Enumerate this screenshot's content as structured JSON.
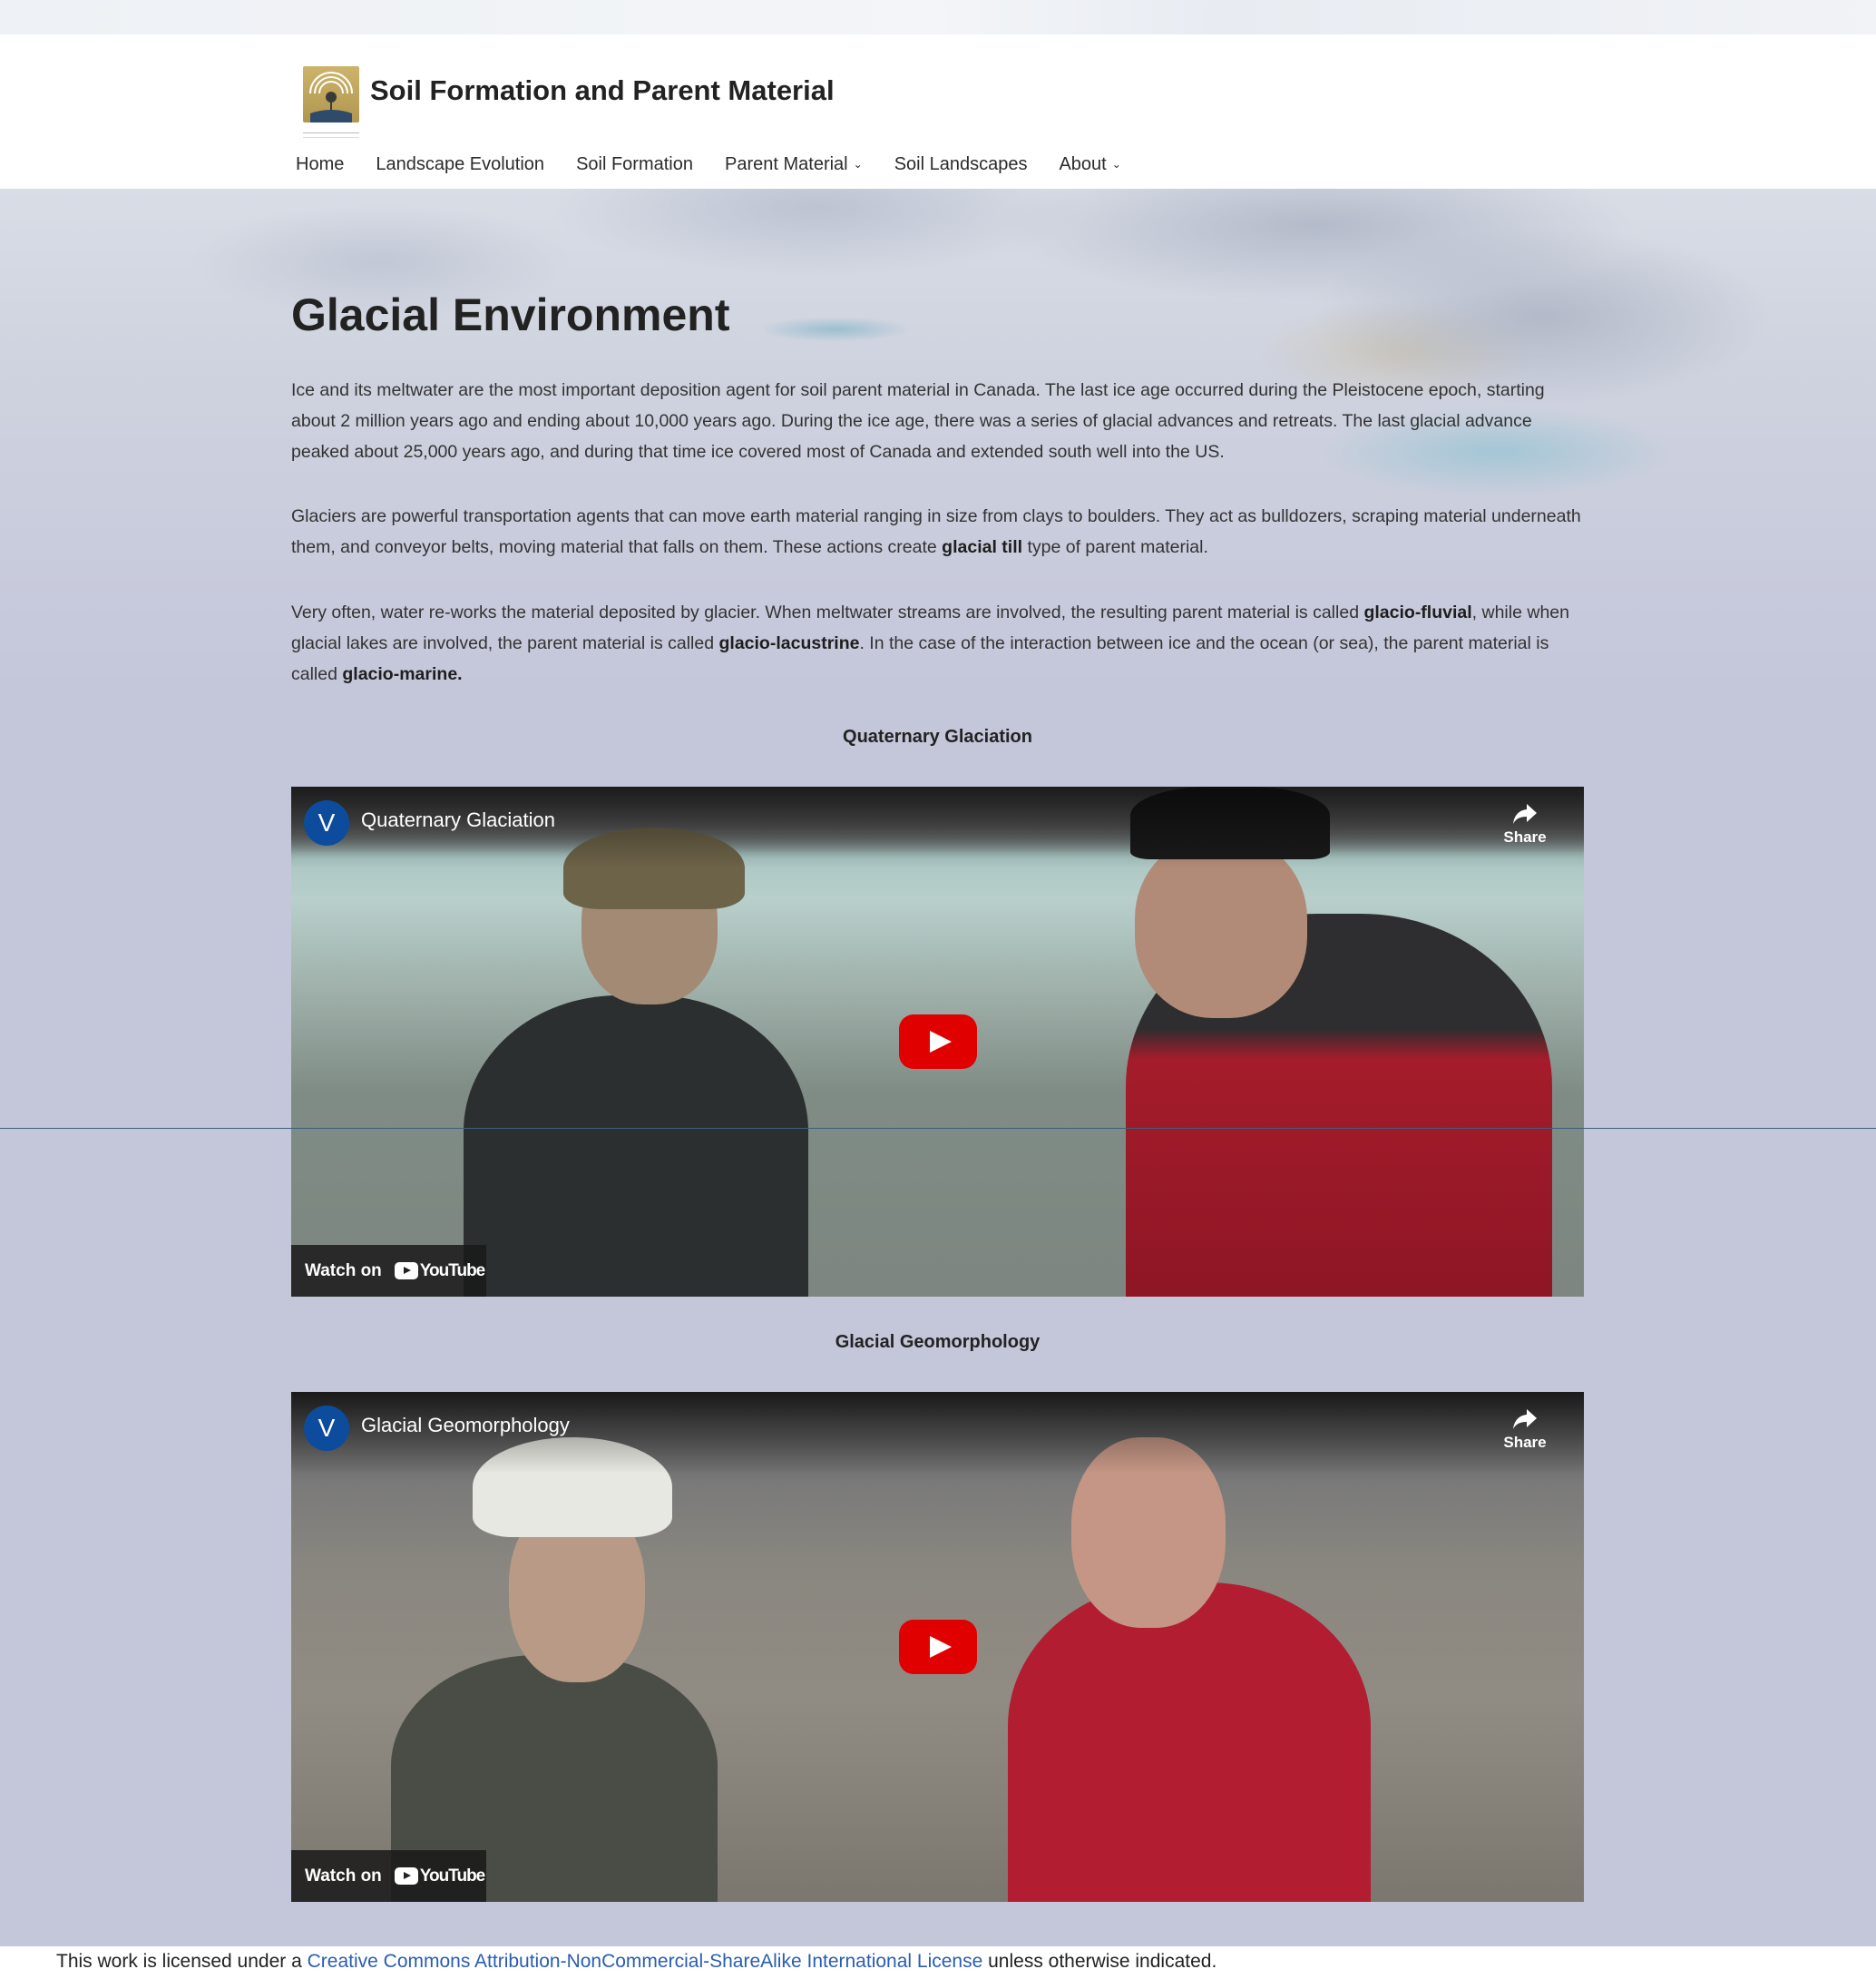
{
  "site": {
    "title": "Soil Formation and Parent Material"
  },
  "nav": {
    "items": [
      {
        "label": "Home",
        "has_dropdown": false
      },
      {
        "label": "Landscape Evolution",
        "has_dropdown": false
      },
      {
        "label": "Soil Formation",
        "has_dropdown": false
      },
      {
        "label": "Parent Material",
        "has_dropdown": true
      },
      {
        "label": "Soil Landscapes",
        "has_dropdown": false
      },
      {
        "label": "About",
        "has_dropdown": true
      }
    ]
  },
  "page": {
    "title": "Glacial Environment",
    "paragraph1": "Ice and its meltwater are the most important deposition agent for soil parent material in Canada. The last ice age occurred during the Pleistocene epoch, starting about 2 million years ago and ending about 10,000 years ago. During the ice age, there was a series of glacial advances and retreats. The last glacial advance peaked about 25,000 years ago, and during that time ice covered most of Canada and extended south well into the US.",
    "paragraph2": {
      "before": "Glaciers are powerful transportation agents that can move earth material ranging in size from clays to boulders. They act as bulldozers, scraping material underneath them, and conveyor belts, moving material that falls on them. These actions create ",
      "bold": "glacial till",
      "after": " type of parent material."
    },
    "paragraph3": {
      "part1": "Very often, water re-works the material deposited by glacier. When meltwater streams are involved, the resulting parent material is called ",
      "bold1": "glacio-fluvial",
      "part2": ", while when glacial lakes are involved, the parent material is called ",
      "bold2": "glacio-lacustrine",
      "part3": ". In the case of the interaction between ice and the ocean (or sea), the parent material is called ",
      "bold3": "glacio-marine."
    }
  },
  "videos": [
    {
      "heading": "Quaternary Glaciation",
      "title": "Quaternary Glaciation",
      "channel_initial": "V",
      "share_label": "Share",
      "watch_on_label": "Watch on",
      "platform": "YouTube"
    },
    {
      "heading": "Glacial Geomorphology",
      "title": "Glacial Geomorphology",
      "channel_initial": "V",
      "share_label": "Share",
      "watch_on_label": "Watch on",
      "platform": "YouTube"
    }
  ],
  "footer": {
    "before": "This work is licensed under a ",
    "link": "Creative Commons Attribution-NonCommercial-ShareAlike International License",
    "after": " unless otherwise indicated."
  },
  "colors": {
    "link": "#2a5db0",
    "youtube_red": "#e00000",
    "channel_avatar": "#0d4c9c"
  }
}
